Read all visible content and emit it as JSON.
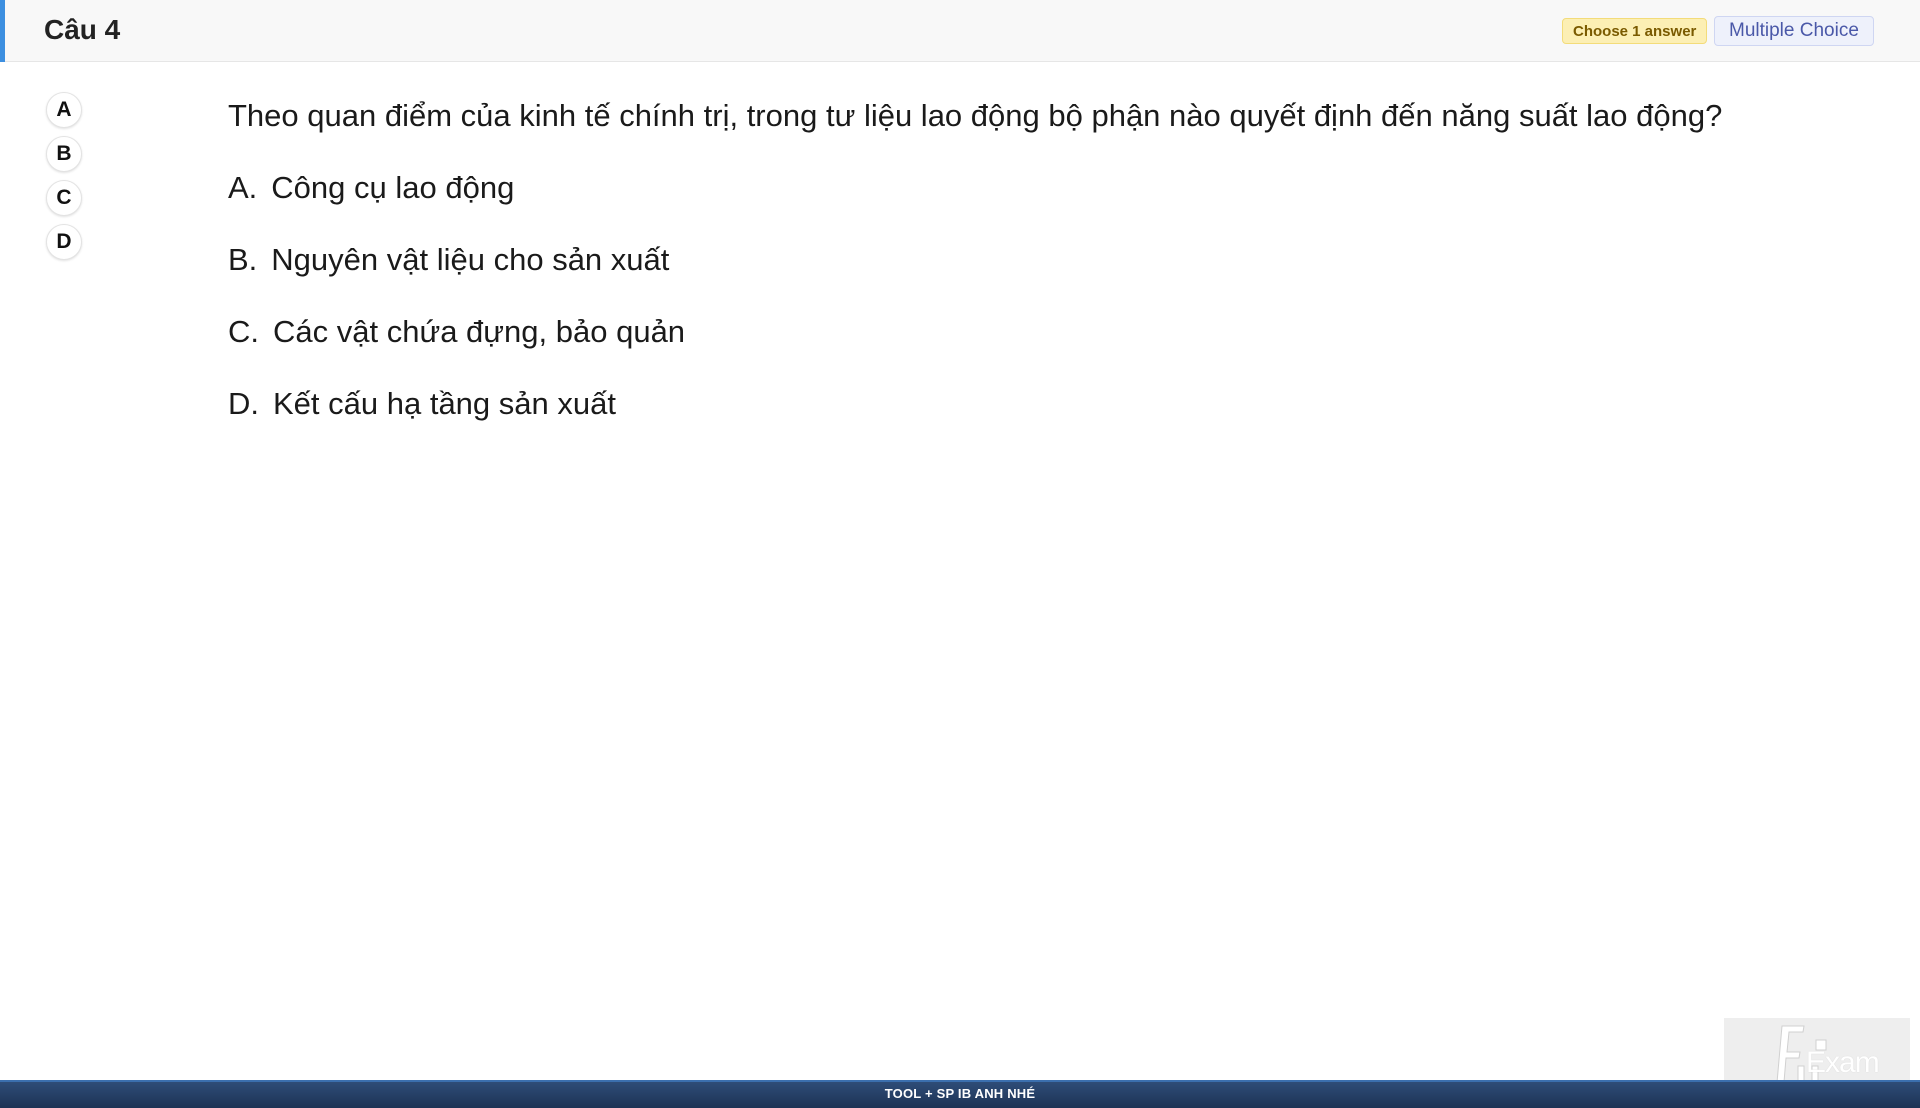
{
  "header": {
    "title": "Câu 4",
    "badge_choose": "Choose 1 answer",
    "badge_type": "Multiple Choice",
    "accent_color": "#3d8fe0"
  },
  "selectors": [
    {
      "label": "A"
    },
    {
      "label": "B"
    },
    {
      "label": "C"
    },
    {
      "label": "D"
    }
  ],
  "question": {
    "text": "Theo quan điểm của kinh tế chính trị, trong tư liệu lao động bộ phận nào quyết định đến năng suất lao động?",
    "options": [
      {
        "letter": "A.",
        "text": "Công cụ lao động"
      },
      {
        "letter": "B.",
        "text": "Nguyên vật liệu cho sản xuất"
      },
      {
        "letter": "C.",
        "text": "Các vật chứa đựng, bảo quản"
      },
      {
        "letter": "D.",
        "text": "Kết cấu hạ tầng sản xuất"
      }
    ]
  },
  "footer": {
    "text": "TOOL + SP IB ANH NHÉ"
  },
  "logo": {
    "text": "Exam",
    "icon": "fu-logo-icon"
  }
}
